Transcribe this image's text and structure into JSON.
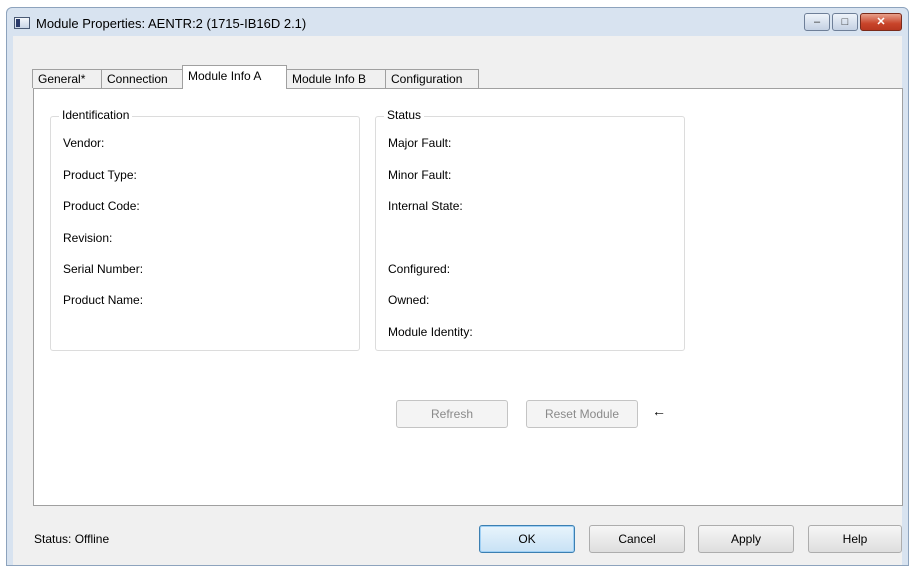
{
  "window": {
    "title": "Module Properties: AENTR:2 (1715-IB16D 2.1)"
  },
  "tabs": [
    {
      "label": "General*"
    },
    {
      "label": "Connection"
    },
    {
      "label": "Module Info A"
    },
    {
      "label": "Module Info B"
    },
    {
      "label": "Configuration"
    }
  ],
  "identification": {
    "title": "Identification",
    "fields": [
      "Vendor:",
      "Product Type:",
      "Product Code:",
      "Revision:",
      "Serial Number:",
      "Product Name:"
    ]
  },
  "status_group": {
    "title": "Status",
    "fields": [
      "Major Fault:",
      "Minor Fault:",
      "Internal State:",
      "Configured:",
      "Owned:",
      "Module Identity:"
    ]
  },
  "actions": {
    "refresh": "Refresh",
    "reset": "Reset Module",
    "arrow": "←"
  },
  "footer": {
    "status": "Status:  Offline",
    "ok": "OK",
    "cancel": "Cancel",
    "apply": "Apply",
    "help": "Help"
  },
  "caption": {
    "minimize": "–",
    "maximize": "□",
    "close": "✕"
  }
}
